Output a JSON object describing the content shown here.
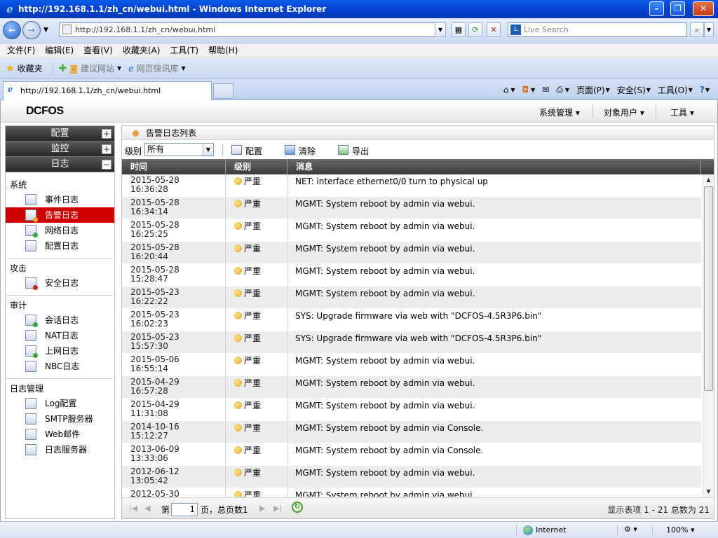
{
  "browser": {
    "window_title": "http://192.168.1.1/zh_cn/webui.html - Windows Internet Explorer",
    "address": "http://192.168.1.1/zh_cn/webui.html",
    "search_placeholder": "Live Search",
    "menu": [
      "文件(F)",
      "编辑(E)",
      "查看(V)",
      "收藏夹(A)",
      "工具(T)",
      "帮助(H)"
    ],
    "favorites": {
      "label": "收藏夹",
      "suggested": "建议网站",
      "webslice": "网页快讯库"
    },
    "tab_title": "http://192.168.1.1/zh_cn/webui.html",
    "command_bar": {
      "page": "页面(P)",
      "safety": "安全(S)",
      "tools": "工具(O)"
    },
    "status": {
      "zone": "Internet",
      "zoom": "100%"
    }
  },
  "app": {
    "logo": "DCFOS",
    "top_menu": [
      "系统管理",
      "对象用户",
      "工具"
    ]
  },
  "sidebar": {
    "accordions": [
      {
        "label": "配置",
        "state": "+"
      },
      {
        "label": "监控",
        "state": "+"
      },
      {
        "label": "日志",
        "state": "−"
      }
    ],
    "groups": [
      {
        "title": "系统",
        "items": [
          "事件日志",
          "告警日志",
          "网络日志",
          "配置日志"
        ]
      },
      {
        "title": "攻击",
        "items": [
          "安全日志"
        ]
      },
      {
        "title": "审计",
        "items": [
          "会话日志",
          "NAT日志",
          "上网日志",
          "NBC日志"
        ]
      },
      {
        "title": "日志管理",
        "items": [
          "Log配置",
          "SMTP服务器",
          "Web邮件",
          "日志服务器"
        ]
      }
    ],
    "selected_item": "告警日志"
  },
  "panel": {
    "title": "告警日志列表",
    "toolbar": {
      "level_label": "级别",
      "level_value": "所有",
      "config": "配置",
      "clear": "清除",
      "export": "导出"
    },
    "columns": [
      "时间",
      "级别",
      "消息"
    ],
    "rows": [
      {
        "date": "2015-05-28",
        "time": "16:36:28",
        "level": "严重",
        "msg": "NET: interface ethernet0/0 turn to physical up"
      },
      {
        "date": "2015-05-28",
        "time": "16:34:14",
        "level": "严重",
        "msg": "MGMT: System reboot by admin via webui."
      },
      {
        "date": "2015-05-28",
        "time": "16:25:25",
        "level": "严重",
        "msg": "MGMT: System reboot by admin via webui."
      },
      {
        "date": "2015-05-28",
        "time": "16:20:44",
        "level": "严重",
        "msg": "MGMT: System reboot by admin via webui."
      },
      {
        "date": "2015-05-28",
        "time": "15:28:47",
        "level": "严重",
        "msg": "MGMT: System reboot by admin via webui."
      },
      {
        "date": "2015-05-23",
        "time": "16:22:22",
        "level": "严重",
        "msg": "MGMT: System reboot by admin via webui."
      },
      {
        "date": "2015-05-23",
        "time": "16:02:23",
        "level": "严重",
        "msg": "SYS: Upgrade firmware via web with \"DCFOS-4.5R3P6.bin\""
      },
      {
        "date": "2015-05-23",
        "time": "15:57:30",
        "level": "严重",
        "msg": "SYS: Upgrade firmware via web with \"DCFOS-4.5R3P6.bin\""
      },
      {
        "date": "2015-05-06",
        "time": "16:55:14",
        "level": "严重",
        "msg": "MGMT: System reboot by admin via webui."
      },
      {
        "date": "2015-04-29",
        "time": "16:57:28",
        "level": "严重",
        "msg": "MGMT: System reboot by admin via webui."
      },
      {
        "date": "2015-04-29",
        "time": "11:31:08",
        "level": "严重",
        "msg": "MGMT: System reboot by admin via webui."
      },
      {
        "date": "2014-10-16",
        "time": "15:12:27",
        "level": "严重",
        "msg": "MGMT: System reboot by admin via Console."
      },
      {
        "date": "2013-06-09",
        "time": "13:33:06",
        "level": "严重",
        "msg": "MGMT: System reboot by admin via Console."
      },
      {
        "date": "2012-06-12",
        "time": "13:05:42",
        "level": "严重",
        "msg": "MGMT: System reboot by admin via webui."
      },
      {
        "date": "2012-05-30",
        "time": "",
        "level": "严重",
        "msg": "MGMT: System reboot by admin via webui."
      }
    ],
    "pager": {
      "page_prefix": "第",
      "page_value": "1",
      "page_suffix": "页，总页数1",
      "summary": "显示表项 1 - 21 总数为 21"
    }
  }
}
